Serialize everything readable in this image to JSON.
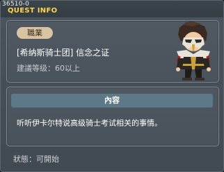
{
  "window": {
    "quest_id": "36510-0",
    "title": "QUEST INFO"
  },
  "quest": {
    "job_badge": "職業",
    "name": "[希纳斯骑士团] 信念之证",
    "level_recommend": "建議等级：60以上",
    "npc_icon": "masked-knight-npc-icon"
  },
  "content": {
    "header": "內容",
    "text": "听听伊卡尔特说高级骑士考试相关的事情。"
  },
  "status": {
    "text": "狀態：可開始"
  },
  "colors": {
    "title_yellow": "#ffd64a",
    "badge_bg": "#d8c4a3",
    "header_bg": "#5d7886"
  }
}
